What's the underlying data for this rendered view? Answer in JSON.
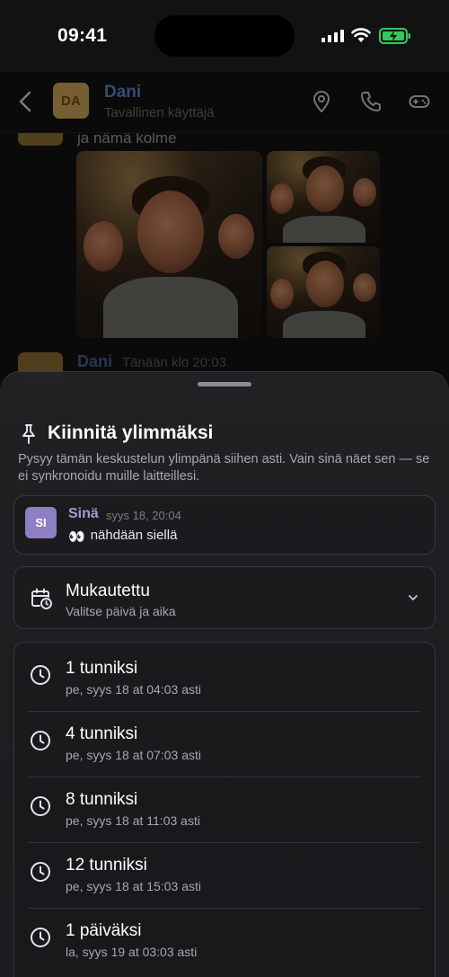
{
  "status": {
    "time": "09:41"
  },
  "header": {
    "avatar_initials": "DA",
    "name": "Dani",
    "subtitle": "Tavallinen käyttäjä"
  },
  "chat": {
    "top_message_text": "ja nämä kolme",
    "second_message_name": "Dani",
    "second_message_time": "Tänään klo 20:03"
  },
  "sheet": {
    "title": "Kiinnitä ylimmäksi",
    "description": "Pysyy tämän keskustelun ylimpänä siihen asti. Vain sinä näet sen — se ei synkronoidu muille laitteillesi.",
    "preview": {
      "avatar_initials": "SI",
      "sender": "Sinä",
      "time": "syys 18, 20:04",
      "emoji": "👀",
      "text": "nähdään siellä"
    },
    "custom": {
      "title": "Mukautettu",
      "subtitle": "Valitse päivä ja aika"
    },
    "options": [
      {
        "title": "1 tunniksi",
        "subtitle": "pe, syys 18 at 04:03 asti"
      },
      {
        "title": "4 tunniksi",
        "subtitle": "pe, syys 18 at 07:03 asti"
      },
      {
        "title": "8 tunniksi",
        "subtitle": "pe, syys 18 at 11:03 asti"
      },
      {
        "title": "12 tunniksi",
        "subtitle": "pe, syys 18 at 15:03 asti"
      },
      {
        "title": "1 päiväksi",
        "subtitle": "la, syys 19 at 03:03 asti"
      }
    ]
  },
  "colors": {
    "accent_blue": "#5b86c9",
    "avatar_yellow": "#caa255",
    "avatar_purple": "#8e7fc2",
    "battery_green": "#34c759"
  },
  "icons": [
    "back-icon",
    "location-icon",
    "phone-icon",
    "gamepad-icon",
    "pin-icon",
    "calendar-clock-icon",
    "chevron-down-icon",
    "clock-icon"
  ]
}
